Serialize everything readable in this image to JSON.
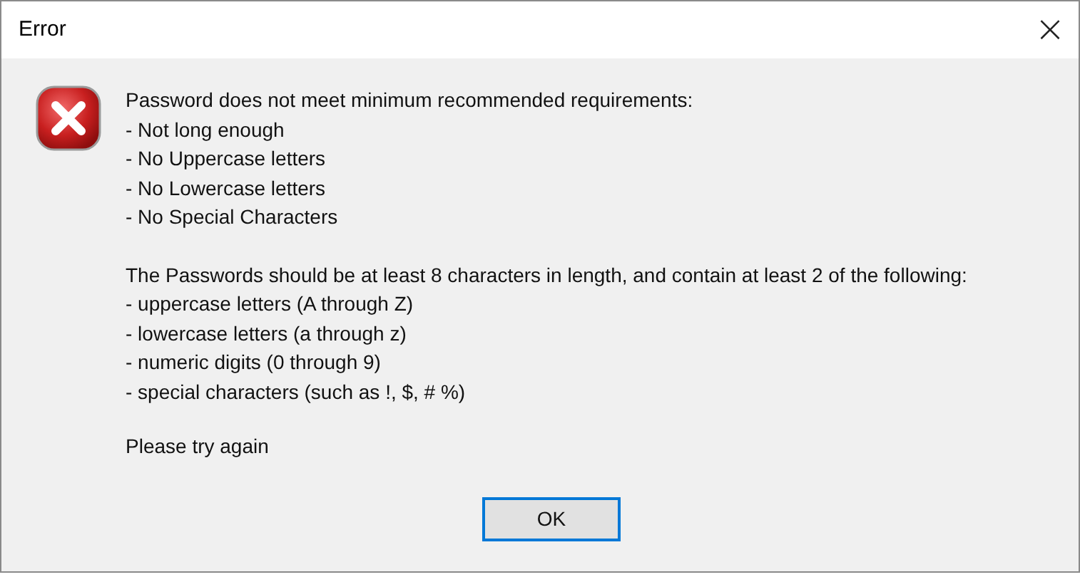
{
  "window": {
    "title": "Error",
    "close": "×"
  },
  "message": {
    "heading": "Password does not meet minimum recommended requirements:",
    "problems": [
      "- Not long enough",
      "- No Uppercase letters",
      "- No Lowercase letters",
      "- No Special Characters"
    ],
    "rule": "The Passwords should be at least 8 characters in length, and contain at least 2 of the following:",
    "options": [
      "- uppercase letters (A through Z)",
      "- lowercase letters (a through z)",
      "- numeric digits (0 through 9)",
      "- special characters (such as !, $, # %)"
    ],
    "closing": "Please try again"
  },
  "buttons": [
    {
      "label": "OK",
      "selected": true
    }
  ]
}
